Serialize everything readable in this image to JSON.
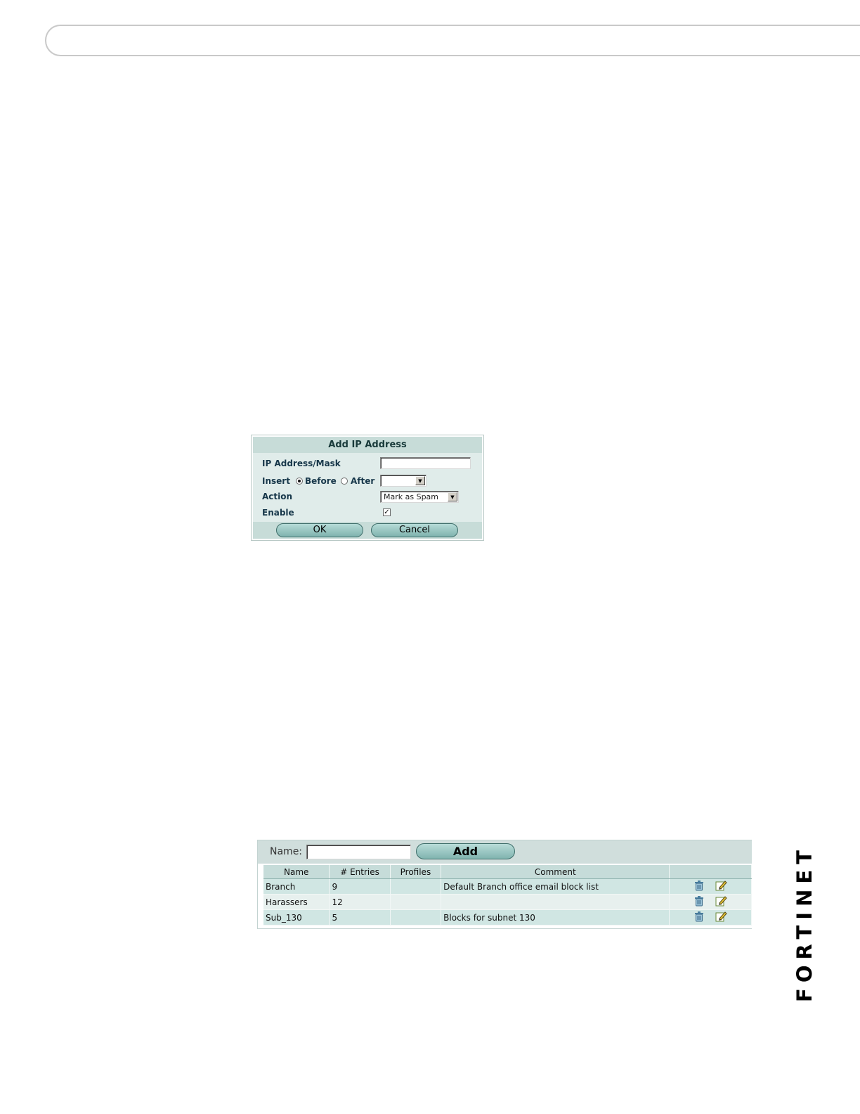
{
  "dialog": {
    "title": "Add IP Address",
    "ip_label": "IP Address/Mask",
    "ip_value": "",
    "insert_label": "Insert",
    "before_label": "Before",
    "after_label": "After",
    "insert_position_selected": "Before",
    "insert_select_value": "",
    "action_label": "Action",
    "action_value": "Mark as Spam",
    "enable_label": "Enable",
    "enable_checked": true,
    "ok_label": "OK",
    "cancel_label": "Cancel"
  },
  "list": {
    "name_label": "Name:",
    "name_value": "",
    "add_label": "Add",
    "columns": [
      "Name",
      "# Entries",
      "Profiles",
      "Comment",
      ""
    ],
    "rows": [
      {
        "name": "Branch",
        "entries": "9",
        "profiles": "",
        "comment": "Default Branch office email block list"
      },
      {
        "name": "Harassers",
        "entries": "12",
        "profiles": "",
        "comment": ""
      },
      {
        "name": "Sub_130",
        "entries": "5",
        "profiles": "",
        "comment": "Blocks for subnet 130"
      }
    ],
    "row_icons": [
      "trash-icon",
      "edit-icon"
    ]
  },
  "logo": {
    "text": "FORTINET"
  },
  "colors": {
    "dialog_bg": "#e0ecea",
    "dialog_header": "#c7dcd8",
    "button": "#8fc1bc",
    "logo_red": "#e0202a"
  }
}
